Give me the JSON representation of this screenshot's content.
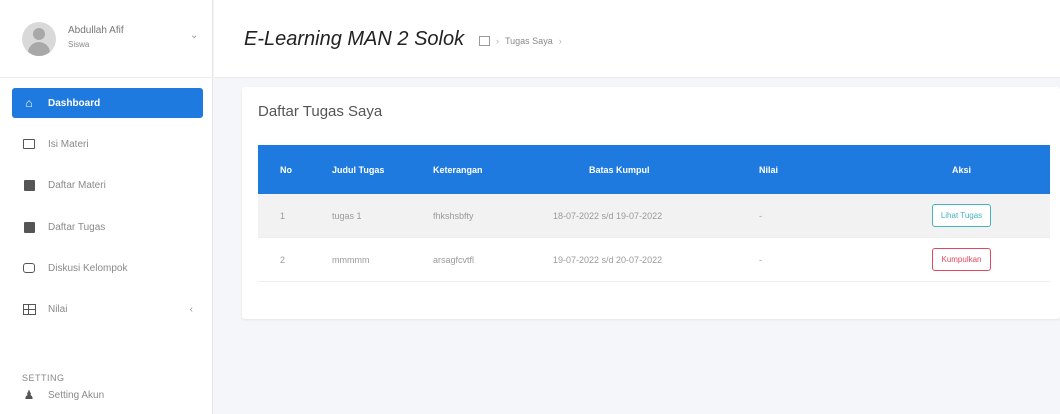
{
  "user": {
    "name": "Abdullah Afif",
    "role": "Siswa"
  },
  "sidebar": {
    "items": [
      {
        "label": "Dashboard",
        "icon": "home-icon",
        "active": true
      },
      {
        "label": "Isi Materi",
        "icon": "monitor-icon"
      },
      {
        "label": "Daftar Materi",
        "icon": "book-icon"
      },
      {
        "label": "Daftar Tugas",
        "icon": "book-icon"
      },
      {
        "label": "Diskusi Kelompok",
        "icon": "chat-icon"
      },
      {
        "label": "Nilai",
        "icon": "table-icon"
      }
    ],
    "section_label": "SETTING",
    "setting_item": {
      "label": "Setting Akun",
      "icon": "user-icon"
    }
  },
  "header": {
    "title": "E-Learning MAN 2 Solok",
    "breadcrumb": {
      "current": "Tugas Saya"
    }
  },
  "card": {
    "title": "Daftar Tugas Saya",
    "table": {
      "headers": [
        "No",
        "Judul Tugas",
        "Keterangan",
        "Batas Kumpul",
        "Nilai",
        "Aksi"
      ],
      "rows": [
        {
          "no": "1",
          "judul": "tugas 1",
          "keterangan": "fhkshsbfty",
          "batas": "18-07-2022 s/d 19-07-2022",
          "nilai": "-",
          "aksi": "Lihat Tugas"
        },
        {
          "no": "2",
          "judul": "mmmmm",
          "keterangan": "arsagfcvtfl",
          "batas": "19-07-2022 s/d 20-07-2022",
          "nilai": "-",
          "aksi": "Kumpulkan"
        }
      ]
    }
  },
  "colors": {
    "primary": "#1f7ae0",
    "info": "#46b3c2",
    "danger": "#e0495d"
  }
}
